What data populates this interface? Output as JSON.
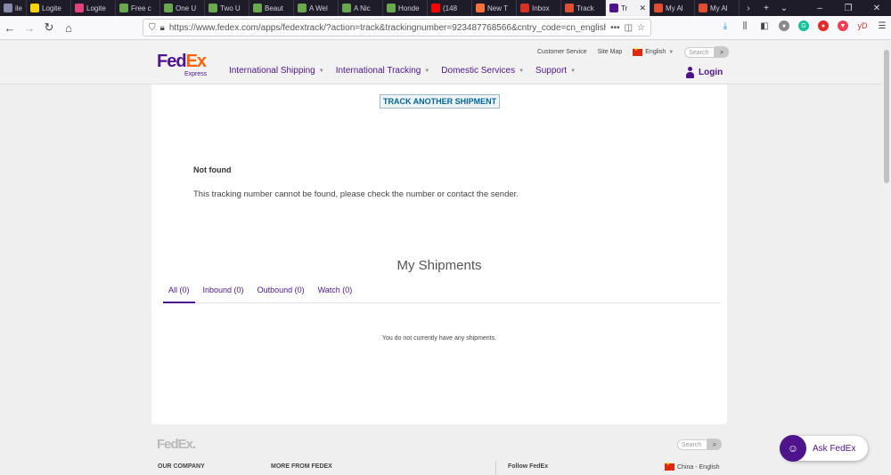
{
  "browser": {
    "tabs": [
      {
        "title": "ile",
        "color": "#8888aa",
        "active": false,
        "first": true
      },
      {
        "title": "Logite",
        "color": "#f7d500",
        "active": false
      },
      {
        "title": "Logite",
        "color": "#e0437a",
        "active": false
      },
      {
        "title": "Free c",
        "color": "#6aa84f",
        "active": false
      },
      {
        "title": "One U",
        "color": "#6aa84f",
        "active": false
      },
      {
        "title": "Two U",
        "color": "#6aa84f",
        "active": false
      },
      {
        "title": "Beaut",
        "color": "#6aa84f",
        "active": false
      },
      {
        "title": "A Wel",
        "color": "#6aa84f",
        "active": false
      },
      {
        "title": "A Nic",
        "color": "#6aa84f",
        "active": false
      },
      {
        "title": "Honde",
        "color": "#6aa84f",
        "active": false
      },
      {
        "title": "(148",
        "color": "#ff0000",
        "active": false
      },
      {
        "title": "New T",
        "color": "#ff7139",
        "active": false
      },
      {
        "title": "Inbox",
        "color": "#d93025",
        "active": false
      },
      {
        "title": "Track",
        "color": "#e04f2f",
        "active": false
      },
      {
        "title": "Tr",
        "color": "#4d148c",
        "active": true
      },
      {
        "title": "My Al",
        "color": "#e04f2f",
        "active": false
      },
      {
        "title": "My Al",
        "color": "#e04f2f",
        "active": false
      }
    ],
    "url": "https://www.fedex.com/apps/fedextrack/?action=track&trackingnumber=923487768566&cntry_code=cn_english&local"
  },
  "header": {
    "logo_fed": "Fed",
    "logo_ex": "Ex",
    "logo_sub": "Express",
    "nav": [
      {
        "label": "International Shipping"
      },
      {
        "label": "International Tracking"
      },
      {
        "label": "Domestic Services"
      },
      {
        "label": "Support"
      }
    ],
    "customer_service": "Customer Service",
    "site_map": "Site Map",
    "language": "English",
    "search_placeholder": "Search",
    "login": "Login"
  },
  "main": {
    "track_another": "TRACK ANOTHER SHIPMENT",
    "not_found_title": "Not found",
    "not_found_message": "This tracking number cannot be found, please check the number or contact the sender.",
    "my_shipments_title": "My Shipments",
    "tabs": [
      {
        "label": "All (0)",
        "active": true
      },
      {
        "label": "Inbound (0)",
        "active": false
      },
      {
        "label": "Outbound (0)",
        "active": false
      },
      {
        "label": "Watch (0)",
        "active": false
      }
    ],
    "empty_message": "You do not currently have any shipments."
  },
  "footer": {
    "logo": "FedEx.",
    "search_placeholder": "Search",
    "our_company": "OUR COMPANY",
    "more_from": "MORE FROM FEDEX",
    "follow": "Follow FedEx",
    "region": "China - English"
  },
  "chat": {
    "label": "Ask FedEx"
  },
  "colors": {
    "fedex_purple": "#4d148c",
    "fedex_orange": "#ff6200",
    "link_blue": "#006699"
  }
}
